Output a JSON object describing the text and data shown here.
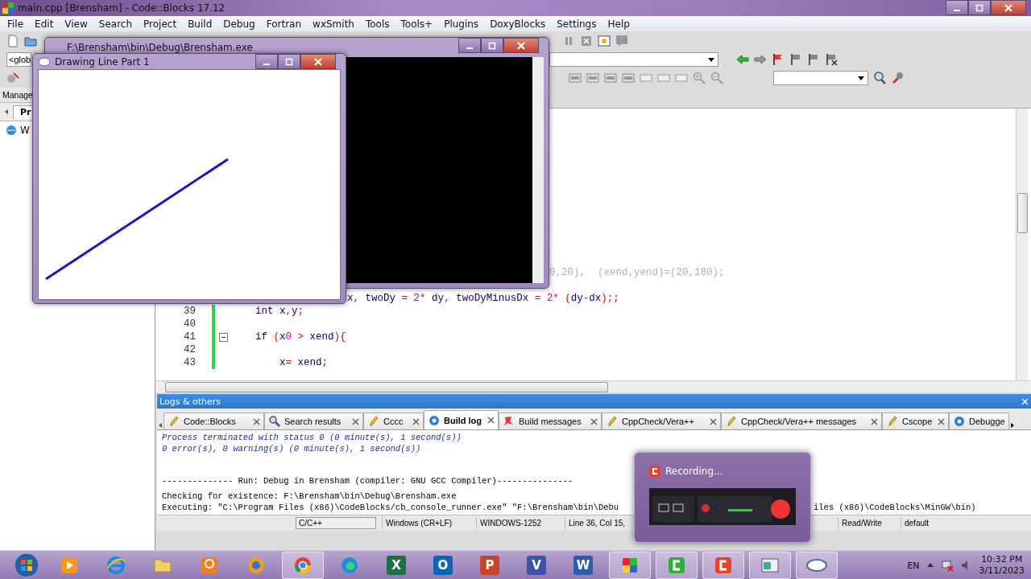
{
  "main_window": {
    "title": "main.cpp [Brensham] - Code::Blocks 17.12"
  },
  "menu": [
    "File",
    "Edit",
    "View",
    "Search",
    "Project",
    "Build",
    "Debug",
    "Fortran",
    "wxSmith",
    "Tools",
    "Tools+",
    "Plugins",
    "DoxyBlocks",
    "Settings",
    "Help"
  ],
  "toolbar": {
    "scope_combo": "<glob"
  },
  "management": {
    "title": "Manage",
    "tab": "Pr",
    "tree_item": "W"
  },
  "editor": {
    "lines": [
      {
        "code": "0,20),  (xend,yend)=(20,180);",
        "kind": "comment_tail"
      },
      {
        "code": "x, twoDy = 2* dy, twoDyMinusDx = 2* (dy-dx);;",
        "kind": "code_tail"
      },
      {
        "number": "39",
        "code": "    int x,y;",
        "kind": "code"
      },
      {
        "number": "40",
        "kind": "code"
      },
      {
        "number": "41",
        "code": "    if (x0 > xend){",
        "kind": "code",
        "fold": true
      },
      {
        "number": "42",
        "kind": "code"
      },
      {
        "number": "43",
        "code": "        x= xend;",
        "kind": "code"
      }
    ]
  },
  "logs": {
    "title": "Logs & others",
    "tabs": [
      {
        "label": "Code::Blocks",
        "selected": false
      },
      {
        "label": "Search results",
        "selected": false
      },
      {
        "label": "Cccc",
        "selected": false
      },
      {
        "label": "Build log",
        "selected": true
      },
      {
        "label": "Build messages",
        "selected": false
      },
      {
        "label": "CppCheck/Vera++",
        "selected": false
      },
      {
        "label": "CppCheck/Vera++ messages",
        "selected": false
      },
      {
        "label": "Cscope",
        "selected": false
      },
      {
        "label": "Debugge",
        "selected": false
      }
    ],
    "lines": [
      {
        "kind": "status",
        "text": "Process terminated with status 0 (0 minute(s), 1 second(s))"
      },
      {
        "kind": "status",
        "text": "0 error(s), 0 warning(s) (0 minute(s), 1 second(s))"
      },
      {
        "kind": "run",
        "text": "-------------- Run: Debug in Brensham (compiler: GNU GCC Compiler)---------------"
      },
      {
        "kind": "plain",
        "text": "Checking for existence: F:\\Brensham\\bin\\Debug\\Brensham.exe"
      },
      {
        "kind": "plain",
        "text": "Executing: \"C:\\Program Files (x86)\\CodeBlocks/cb_console_runner.exe\" \"F:\\Brensham\\bin\\Debu",
        "tail": "iles (x86)\\CodeBlocks\\MinGW\\bin)"
      }
    ]
  },
  "status_bar": {
    "items": [
      {
        "text": "C/C++",
        "kind": "field"
      },
      {
        "text": "Windows (CR+LF)",
        "kind": "plain"
      },
      {
        "text": "WINDOWS-1252",
        "kind": "plain"
      },
      {
        "text": "Line 36, Col 15,",
        "kind": "plain"
      },
      {
        "text": "Read/Write",
        "kind": "plain"
      },
      {
        "text": "default",
        "kind": "plain"
      }
    ]
  },
  "console_window": {
    "title": "F:\\Brensham\\bin\\Debug\\Brensham.exe"
  },
  "drawing_window": {
    "title": "Drawing Line Part 1"
  },
  "recording_popup": {
    "title": "Recording..."
  },
  "taskbar": {
    "apps": [
      {
        "kind": "media",
        "running": false
      },
      {
        "kind": "ie",
        "running": false
      },
      {
        "kind": "folder",
        "running": false
      },
      {
        "kind": "pdf",
        "running": false
      },
      {
        "kind": "rings",
        "running": false
      },
      {
        "kind": "chrome",
        "running": true
      },
      {
        "kind": "edge",
        "running": false
      },
      {
        "kind": "office",
        "glyph": "X",
        "color": "#1d7044",
        "running": false
      },
      {
        "kind": "office",
        "glyph": "O",
        "color": "#0a64b8",
        "running": false
      },
      {
        "kind": "office",
        "glyph": "P",
        "color": "#c8442a",
        "running": false
      },
      {
        "kind": "office",
        "glyph": "V",
        "color": "#3a55a8",
        "running": false
      },
      {
        "kind": "office",
        "glyph": "W",
        "color": "#2b5cad",
        "running": false
      },
      {
        "kind": "codeblocks",
        "running": true
      },
      {
        "kind": "camtasia",
        "running": true
      },
      {
        "kind": "recorder",
        "running": true
      },
      {
        "kind": "notepad",
        "running": true
      },
      {
        "kind": "opengl",
        "running": true
      }
    ],
    "language": "EN",
    "time": "10:32 PM",
    "date": "3/11/2023"
  }
}
